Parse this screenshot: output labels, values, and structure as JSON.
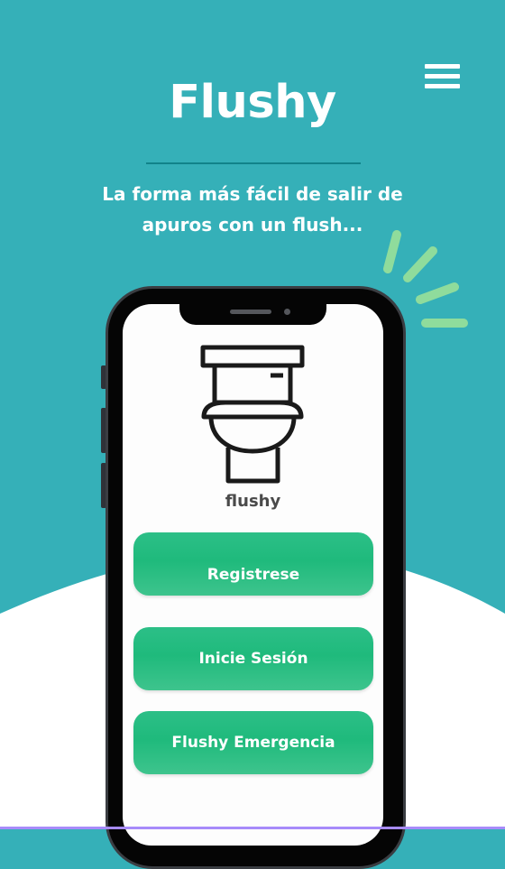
{
  "header": {
    "title": "Flushy",
    "subtitle_line1": "La forma más fácil de salir de",
    "subtitle_line2": "apuros con un flush...",
    "menu_icon": "hamburger-menu-icon"
  },
  "phone": {
    "app_label": "flushy",
    "buttons": [
      {
        "label": "Registrese"
      },
      {
        "label": "Inicie Sesión"
      },
      {
        "label": "Flushy Emergencia"
      }
    ]
  },
  "colors": {
    "background": "#35b0b8",
    "accent_green": "#22bb7f",
    "divider": "#11838a",
    "sparkle": "#8fdc9c"
  }
}
